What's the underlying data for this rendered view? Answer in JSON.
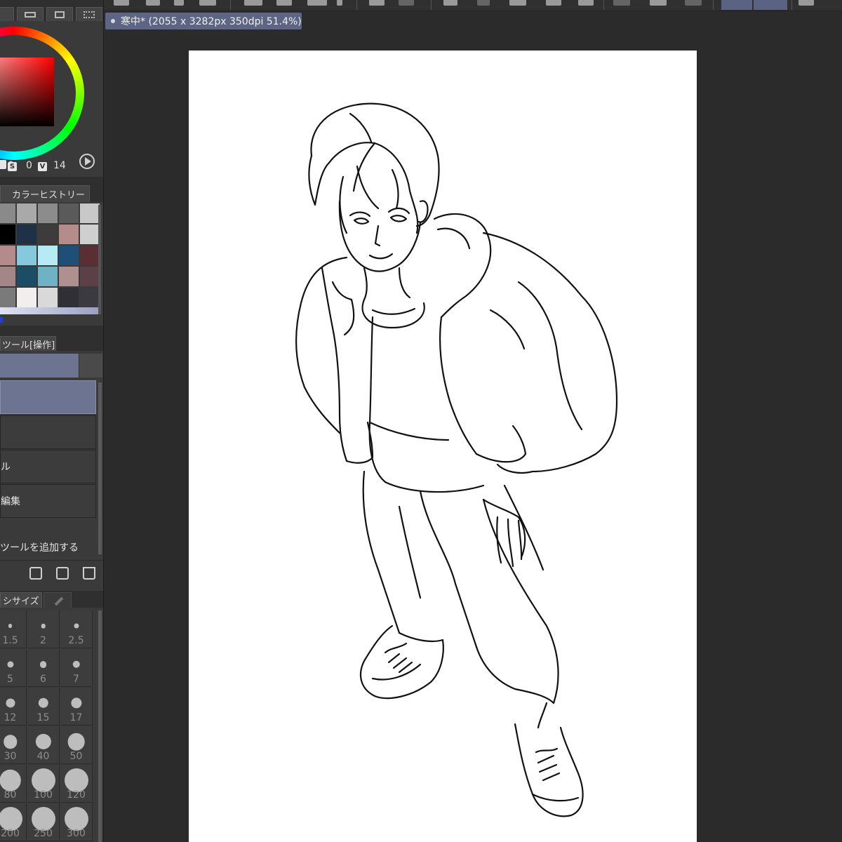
{
  "document": {
    "tab_title": "寒中* (2055 x 3282px 350dpi 51.4%)"
  },
  "color_panel": {
    "h_value": "0",
    "s_badge": "S",
    "s_value": "0",
    "v_badge": "V",
    "v_value": "14",
    "hue_color": "#ff0000"
  },
  "color_history": {
    "title": "カラーヒストリー",
    "swatches": [
      "#8a8a8a",
      "#a9a9a9",
      "#8c8c8c",
      "#5a5a5a",
      "#c8c8c8",
      "#000000",
      "#1e3147",
      "#3e3b3d",
      "#b58c89",
      "#cfcfcf",
      "#b48a8a",
      "#86c8dc",
      "#b6eaf5",
      "#1f4f78",
      "#5a2f33",
      "#a48689",
      "#1b4d66",
      "#6fb2c6",
      "#b08f8f",
      "#5b4147",
      "#7a7a7a",
      "#f2eeee",
      "#d9d9d9",
      "#2f2f35",
      "#3a3a40"
    ]
  },
  "sub_tool": {
    "header": "ツール[操作]",
    "items": [
      {
        "label": ""
      },
      {
        "label": ""
      },
      {
        "label": "ル"
      },
      {
        "label": "編集"
      }
    ],
    "add_label": "ツールを追加する"
  },
  "brush_size": {
    "header": "シサイズ",
    "sizes": [
      "1.5",
      "2",
      "2.5",
      "5",
      "6",
      "7",
      "12",
      "15",
      "17",
      "30",
      "40",
      "50",
      "80",
      "100",
      "120",
      "200",
      "250",
      "300"
    ]
  }
}
